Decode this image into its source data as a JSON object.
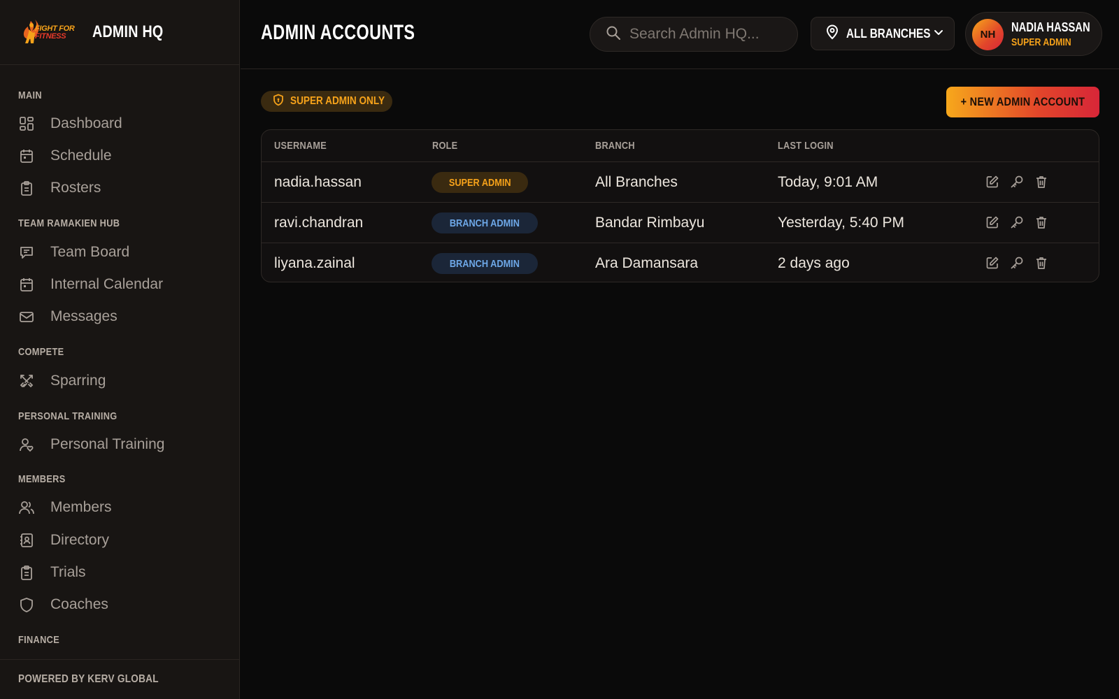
{
  "brand": {
    "logo_line1": "FIGHT FOR",
    "logo_line2": "FITNESS",
    "title": "ADMIN HQ"
  },
  "sidebar": {
    "sections": [
      {
        "label": "MAIN",
        "items": [
          {
            "label": "Dashboard",
            "icon": "dashboard-icon"
          },
          {
            "label": "Schedule",
            "icon": "calendar-icon"
          },
          {
            "label": "Rosters",
            "icon": "clipboard-icon"
          }
        ]
      },
      {
        "label": "TEAM RAMAKIEN HUB",
        "items": [
          {
            "label": "Team Board",
            "icon": "chat-icon"
          },
          {
            "label": "Internal Calendar",
            "icon": "calendar-icon"
          },
          {
            "label": "Messages",
            "icon": "mail-icon"
          }
        ]
      },
      {
        "label": "COMPETE",
        "items": [
          {
            "label": "Sparring",
            "icon": "swords-icon"
          }
        ]
      },
      {
        "label": "PERSONAL TRAINING",
        "items": [
          {
            "label": "Personal Training",
            "icon": "user-heart-icon"
          }
        ]
      },
      {
        "label": "MEMBERS",
        "items": [
          {
            "label": "Members",
            "icon": "users-icon"
          },
          {
            "label": "Directory",
            "icon": "contact-book-icon"
          },
          {
            "label": "Trials",
            "icon": "clipboard-icon"
          },
          {
            "label": "Coaches",
            "icon": "shield-icon"
          }
        ]
      },
      {
        "label": "FINANCE",
        "items": []
      }
    ],
    "footer": "POWERED BY KERV GLOBAL"
  },
  "header": {
    "title": "ADMIN ACCOUNTS",
    "search_placeholder": "Search Admin HQ...",
    "branch_filter": "ALL BRANCHES",
    "user": {
      "initials": "NH",
      "name": "NADIA HASSAN",
      "role": "SUPER ADMIN"
    }
  },
  "main": {
    "access_badge": "SUPER ADMIN ONLY",
    "new_button": "+ NEW ADMIN ACCOUNT",
    "table": {
      "columns": [
        "USERNAME",
        "ROLE",
        "BRANCH",
        "LAST LOGIN"
      ],
      "rows": [
        {
          "username": "nadia.hassan",
          "role": "SUPER ADMIN",
          "role_type": "super",
          "branch": "All Branches",
          "last_login": "Today, 9:01 AM"
        },
        {
          "username": "ravi.chandran",
          "role": "BRANCH ADMIN",
          "role_type": "branch",
          "branch": "Bandar Rimbayu",
          "last_login": "Yesterday, 5:40 PM"
        },
        {
          "username": "liyana.zainal",
          "role": "BRANCH ADMIN",
          "role_type": "branch",
          "branch": "Ara Damansara",
          "last_login": "2 days ago"
        }
      ]
    }
  },
  "colors": {
    "accent_orange": "#f6a21a",
    "accent_red": "#d72638",
    "branch_blue": "#6ea8e8",
    "background": "#0a0a0a",
    "sidebar_bg": "#181513"
  }
}
